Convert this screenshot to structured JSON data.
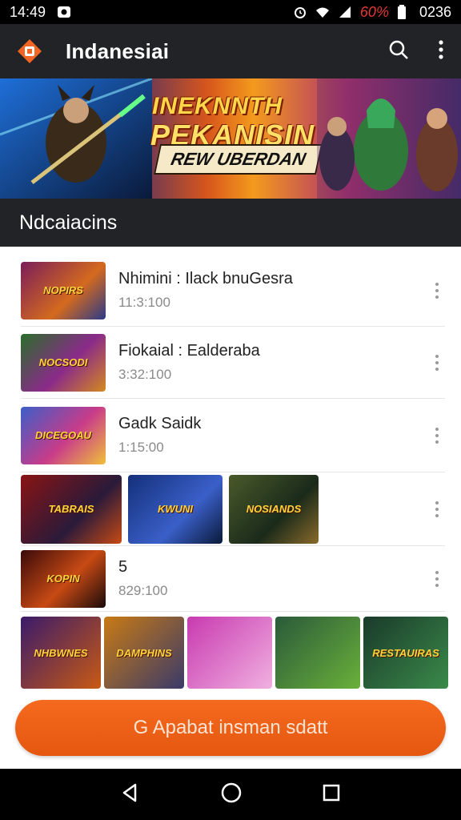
{
  "status_bar": {
    "time": "14:49",
    "battery": "60%",
    "clock_right": "0236",
    "icons": [
      "notification-icon",
      "alarm-icon",
      "signal-icon",
      "battery-icon"
    ]
  },
  "app_bar": {
    "title": "Indanesiai",
    "logo_icon": "app-logo-icon",
    "search_icon": "search-icon",
    "menu_icon": "more-vert-icon",
    "accent": "#f26522"
  },
  "banner": {
    "line1": "INEKNNTH",
    "line2": "PEKANISIN",
    "subtitle": "REW UBERDAN"
  },
  "section": {
    "title": "Ndcaiacins"
  },
  "list": [
    {
      "title": "Nhimini : Ilack bnuGesra",
      "meta": "11:3:100",
      "thumb_text": "NOPIRS",
      "thumb_colors": [
        "#7a1d5a",
        "#d46a1e"
      ]
    },
    {
      "title": "Fiokaial : Ealderaba",
      "meta": "3:32:100",
      "thumb_text": "NOCSODI",
      "thumb_colors": [
        "#2b6e2a",
        "#8a2a8a"
      ]
    },
    {
      "title": "Gadk Saidk",
      "meta": "1:15:00",
      "thumb_text": "DICEGOAU",
      "thumb_colors": [
        "#3b5fc8",
        "#c83b8a"
      ]
    },
    {
      "title": "",
      "meta": "",
      "thumbs": [
        {
          "text": "TABRAIS",
          "colors": [
            "#8a1414",
            "#2a1a3a"
          ]
        },
        {
          "text": "KWUNI",
          "colors": [
            "#14307a",
            "#3a5fc8"
          ]
        },
        {
          "text": "NOSIANDS",
          "colors": [
            "#4a5a2a",
            "#1a2a1a"
          ]
        }
      ]
    },
    {
      "title": "5",
      "meta": "829:100",
      "thumb_text": "KOPIN",
      "thumb_colors": [
        "#3a0a0a",
        "#c84a14"
      ]
    }
  ],
  "gallery": [
    {
      "text": "NHBWNES",
      "colors": [
        "#3a1a6a",
        "#c85a14"
      ]
    },
    {
      "text": "DAMPHINS",
      "colors": [
        "#c87a14",
        "#3a3a6a"
      ]
    },
    {
      "text": "",
      "colors": [
        "#c83ab0",
        "#f0b0e0"
      ]
    },
    {
      "text": "",
      "colors": [
        "#2a5a3a",
        "#6ab03a"
      ]
    },
    {
      "text": "RESTAUIRAS",
      "colors": [
        "#1a3a2a",
        "#3a8a4a"
      ]
    }
  ],
  "cta": {
    "label": "G Apabat insman sdatt"
  },
  "nav": {
    "back_icon": "back-icon",
    "home_icon": "home-icon",
    "recents_icon": "recents-icon"
  }
}
